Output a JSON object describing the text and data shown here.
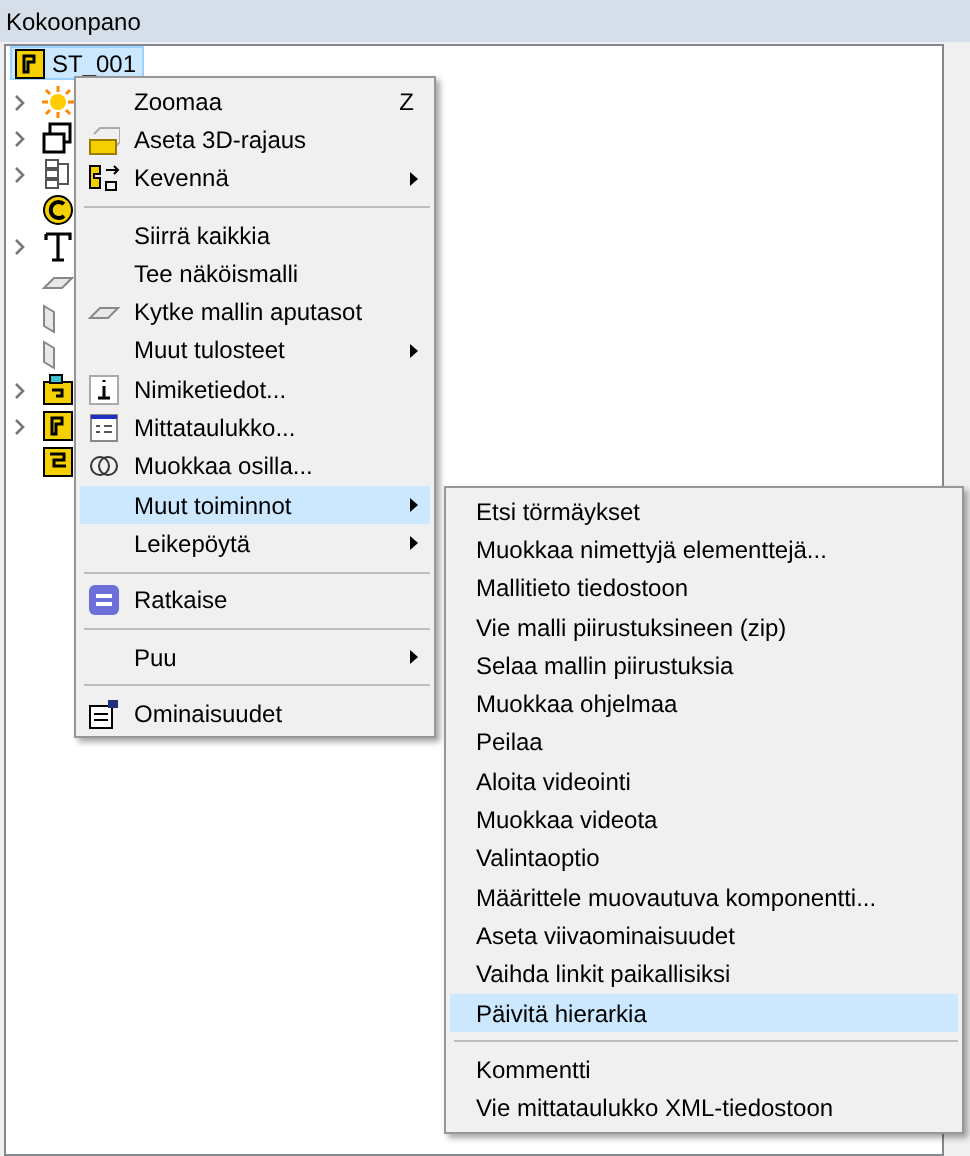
{
  "panel": {
    "title": "Kokoonpano"
  },
  "tree": {
    "root": {
      "label": "ST_001",
      "selected": true,
      "kind": "assembly"
    },
    "children": [
      {
        "expandable": true,
        "kind": "sun"
      },
      {
        "expandable": true,
        "kind": "copy"
      },
      {
        "expandable": true,
        "kind": "hierarchy"
      },
      {
        "expandable": false,
        "kind": "magnet"
      },
      {
        "expandable": true,
        "kind": "text"
      },
      {
        "expandable": false,
        "kind": "plane"
      },
      {
        "expandable": false,
        "kind": "prism"
      },
      {
        "expandable": false,
        "kind": "prism"
      },
      {
        "expandable": true,
        "kind": "assembly-tag"
      },
      {
        "expandable": true,
        "kind": "assembly"
      },
      {
        "expandable": false,
        "kind": "assembly-alt"
      }
    ]
  },
  "context_menu": {
    "items": [
      {
        "kind": "item",
        "label": "Zoomaa",
        "shortcut": "Z",
        "submenu": false,
        "selected": false
      },
      {
        "kind": "item",
        "label": "Aseta 3D-rajaus",
        "submenu": false,
        "selected": false
      },
      {
        "kind": "item",
        "label": "Kevennä",
        "submenu": true,
        "selected": false
      },
      {
        "kind": "separator"
      },
      {
        "kind": "item",
        "label": "Siirrä kaikkia",
        "submenu": false,
        "selected": false
      },
      {
        "kind": "item",
        "label": "Tee näköismalli",
        "submenu": false,
        "selected": false
      },
      {
        "kind": "item",
        "label": "Kytke mallin aputasot",
        "submenu": false,
        "selected": false
      },
      {
        "kind": "item",
        "label": "Muut tulosteet",
        "submenu": true,
        "selected": false
      },
      {
        "kind": "item",
        "label": "Nimiketiedot...",
        "submenu": false,
        "selected": false
      },
      {
        "kind": "item",
        "label": "Mittataulukko...",
        "submenu": false,
        "selected": false
      },
      {
        "kind": "item",
        "label": "Muokkaa osilla...",
        "submenu": false,
        "selected": false
      },
      {
        "kind": "item",
        "label": "Muut toiminnot",
        "submenu": true,
        "selected": true
      },
      {
        "kind": "item",
        "label": "Leikepöytä",
        "submenu": true,
        "selected": false
      },
      {
        "kind": "separator"
      },
      {
        "kind": "item",
        "label": "Ratkaise",
        "submenu": false,
        "selected": false
      },
      {
        "kind": "separator"
      },
      {
        "kind": "item",
        "label": "Puu",
        "submenu": true,
        "selected": false
      },
      {
        "kind": "separator"
      },
      {
        "kind": "item",
        "label": "Ominaisuudet",
        "submenu": false,
        "selected": false
      }
    ]
  },
  "submenu": {
    "items": [
      {
        "kind": "item",
        "label": "Etsi törmäykset",
        "selected": false
      },
      {
        "kind": "item",
        "label": "Muokkaa nimettyjä elementtejä...",
        "selected": false
      },
      {
        "kind": "item",
        "label": "Mallitieto tiedostoon",
        "selected": false
      },
      {
        "kind": "item",
        "label": "Vie malli piirustuksineen (zip)",
        "selected": false
      },
      {
        "kind": "item",
        "label": "Selaa mallin piirustuksia",
        "selected": false
      },
      {
        "kind": "item",
        "label": "Muokkaa ohjelmaa",
        "selected": false
      },
      {
        "kind": "item",
        "label": "Peilaa",
        "selected": false
      },
      {
        "kind": "item",
        "label": "Aloita videointi",
        "selected": false
      },
      {
        "kind": "item",
        "label": "Muokkaa videota",
        "selected": false
      },
      {
        "kind": "item",
        "label": "Valintaoptio",
        "selected": false
      },
      {
        "kind": "item",
        "label": "Määrittele muovautuva komponentti...",
        "selected": false
      },
      {
        "kind": "item",
        "label": "Aseta viivaominaisuudet",
        "selected": false
      },
      {
        "kind": "item",
        "label": "Vaihda linkit paikallisiksi",
        "selected": false
      },
      {
        "kind": "item",
        "label": "Päivitä hierarkia",
        "selected": true
      },
      {
        "kind": "separator"
      },
      {
        "kind": "item",
        "label": "Kommentti",
        "selected": false
      },
      {
        "kind": "item",
        "label": "Vie mittataulukko XML-tiedostoon",
        "selected": false
      }
    ]
  }
}
